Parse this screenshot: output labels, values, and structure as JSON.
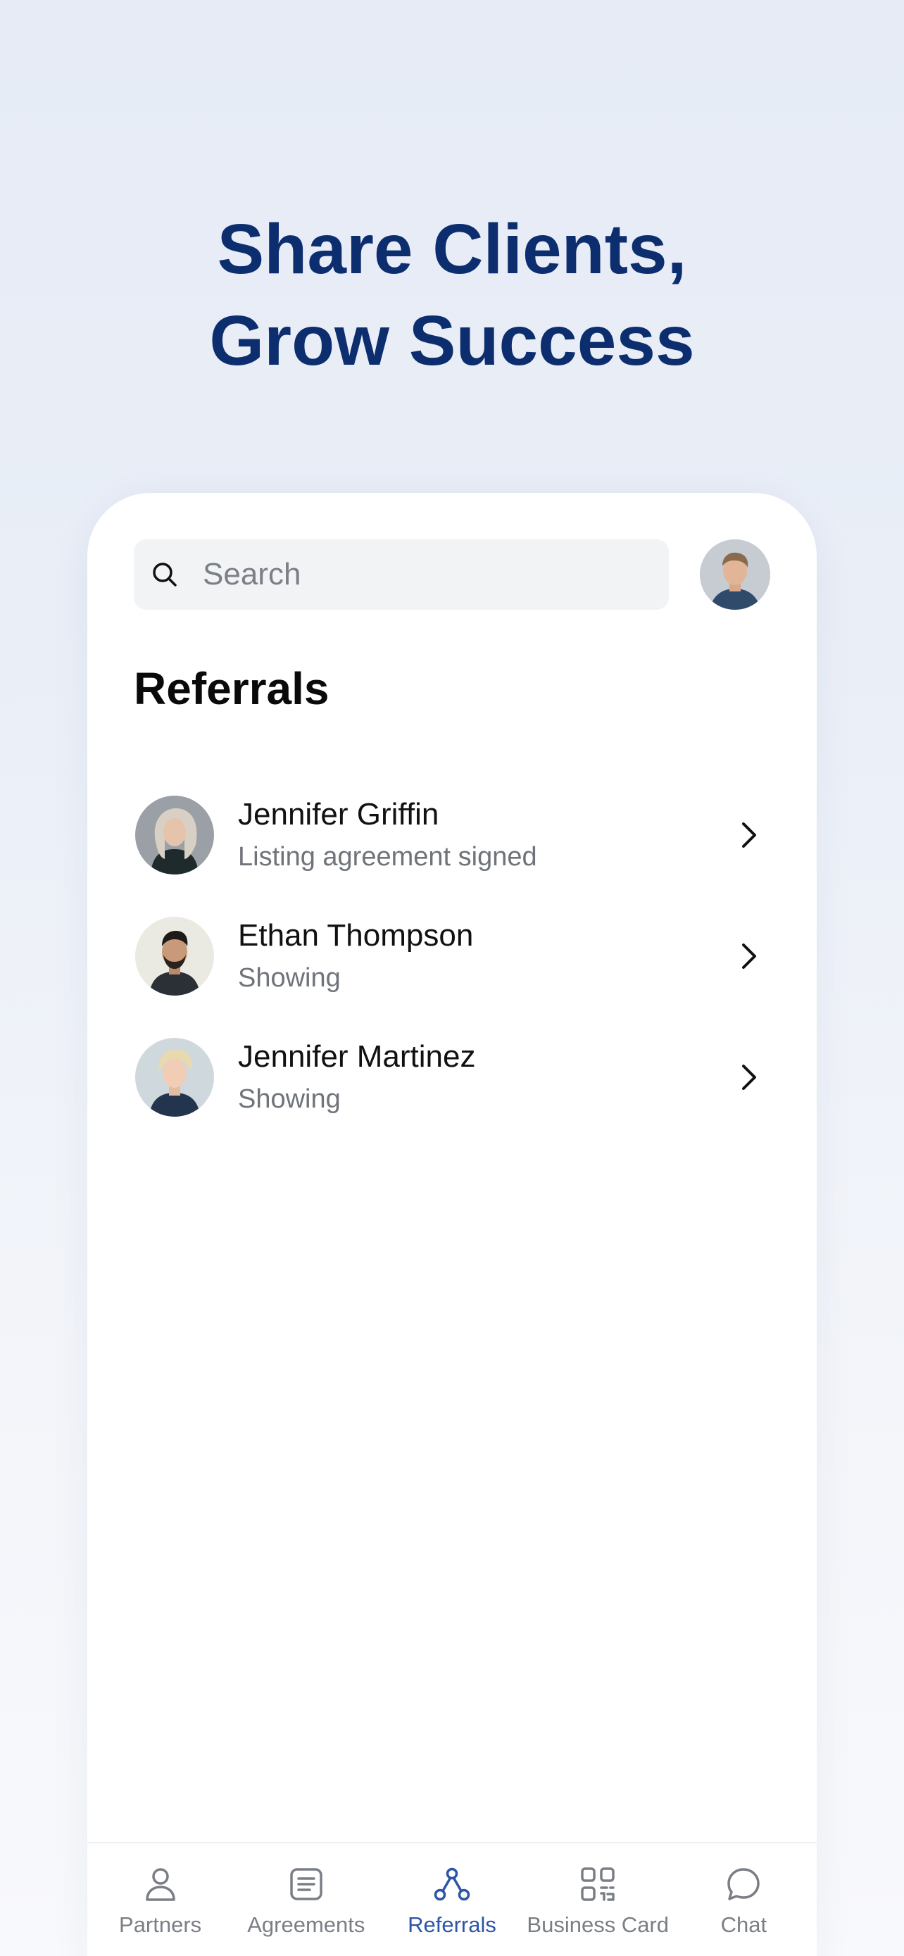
{
  "hero": {
    "line1": "Share Clients,",
    "line2": "Grow Success"
  },
  "search": {
    "placeholder": "Search",
    "value": ""
  },
  "section_title": "Referrals",
  "referrals": [
    {
      "name": "Jennifer Griffin",
      "status": "Listing agreement signed"
    },
    {
      "name": "Ethan Thompson",
      "status": "Showing"
    },
    {
      "name": "Jennifer Martinez",
      "status": "Showing"
    }
  ],
  "tabs": [
    {
      "label": "Partners",
      "icon": "person-icon",
      "active": false
    },
    {
      "label": "Agreements",
      "icon": "document-icon",
      "active": false
    },
    {
      "label": "Referrals",
      "icon": "network-icon",
      "active": true
    },
    {
      "label": "Business Card",
      "icon": "qr-code-icon",
      "active": false
    },
    {
      "label": "Chat",
      "icon": "chat-bubble-icon",
      "active": false
    }
  ],
  "colors": {
    "headline": "#0d2e6e",
    "accent": "#2a55a8",
    "muted_text": "#6f737a",
    "search_bg": "#f2f3f5"
  }
}
